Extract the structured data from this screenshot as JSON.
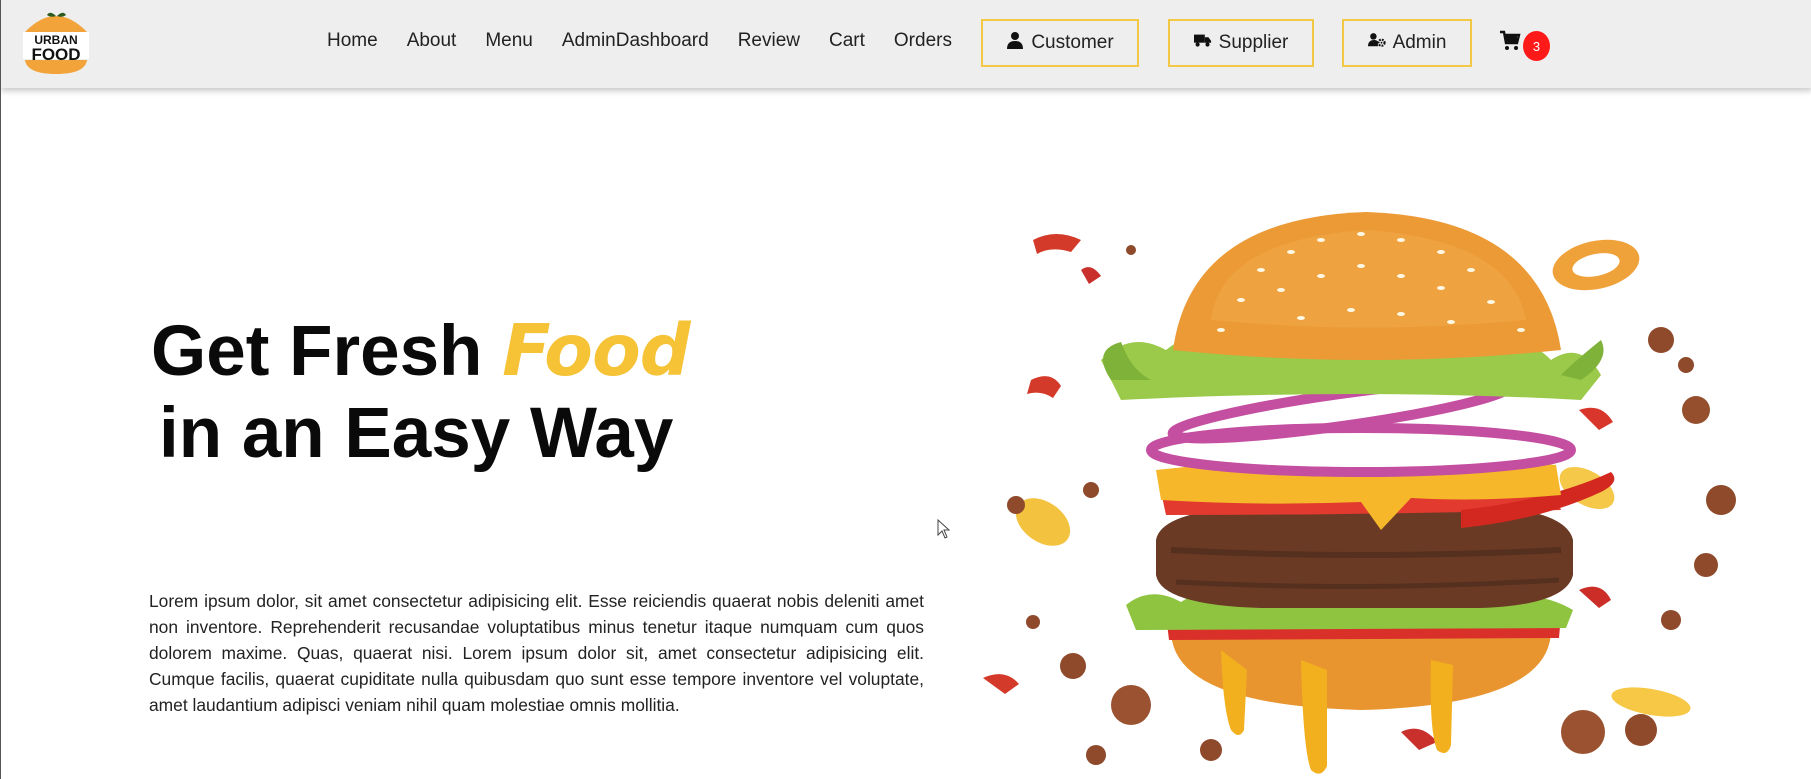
{
  "brand": {
    "logo_line1": "URBAN",
    "logo_line2": "FOOD",
    "logo_color": "#f2a33a"
  },
  "nav": {
    "links": [
      "Home",
      "About",
      "Menu",
      "AdminDashboard",
      "Review",
      "Cart",
      "Orders"
    ],
    "roles": [
      {
        "label": "Customer",
        "icon": "user-icon"
      },
      {
        "label": "Supplier",
        "icon": "truck-icon"
      },
      {
        "label": "Admin",
        "icon": "user-gear-icon"
      }
    ],
    "cart_icon": "cart-icon",
    "cart_count": "3",
    "accent_border": "#f3c845",
    "badge_color": "#ff1a1a"
  },
  "hero": {
    "title_part1": "Get Fresh",
    "title_accent": "Food",
    "title_line2": "in an Easy Way",
    "accent_color": "#f6c236",
    "body": "Lorem ipsum dolor, sit amet consectetur adipisicing elit. Esse reiciendis quaerat nobis deleniti amet non inventore. Reprehenderit recusandae voluptatibus minus tenetur itaque numquam cum quos dolorem maxime. Quas, quaerat nisi. Lorem ipsum dolor sit, amet consectetur adipisicing elit. Cumque facilis, quaerat cupiditate nulla quibusdam quo sunt esse tempore inventore vel voluptate, amet laudantium adipisci veniam nihil quam molestiae omnis mollitia.",
    "image": "burger-image"
  }
}
